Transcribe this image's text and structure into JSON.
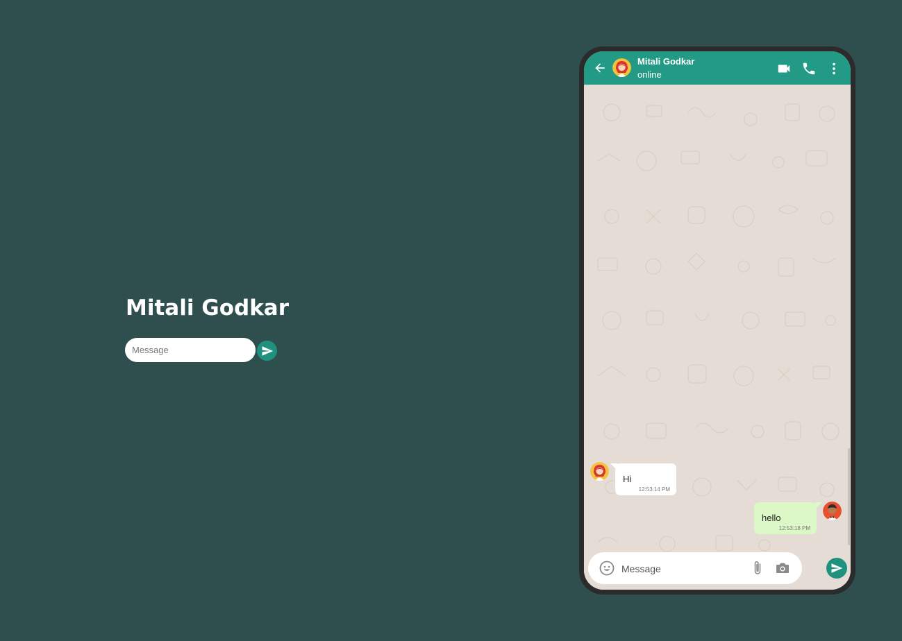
{
  "left_panel": {
    "title": "Mitali Godkar",
    "input_placeholder": "Message"
  },
  "chat": {
    "contact_name": "Mitali Godkar",
    "status": "online",
    "messages": [
      {
        "direction": "in",
        "text": "Hi",
        "time": "12:53:14 PM"
      },
      {
        "direction": "out",
        "text": "hello",
        "time": "12:53:18 PM"
      }
    ],
    "composer_placeholder": "Message"
  },
  "icons": {
    "back": "arrow-left-icon",
    "video": "video-camera-icon",
    "call": "phone-icon",
    "menu": "more-vertical-icon",
    "emoji": "emoji-icon",
    "attach": "paperclip-icon",
    "camera": "camera-icon",
    "send": "send-icon"
  },
  "colors": {
    "page_background": "#2f4f4f",
    "accent": "#239a86",
    "send_button": "#20907f",
    "chat_background": "#e5ddd5",
    "incoming_bubble": "#ffffff",
    "outgoing_bubble": "#dcf8c6"
  }
}
